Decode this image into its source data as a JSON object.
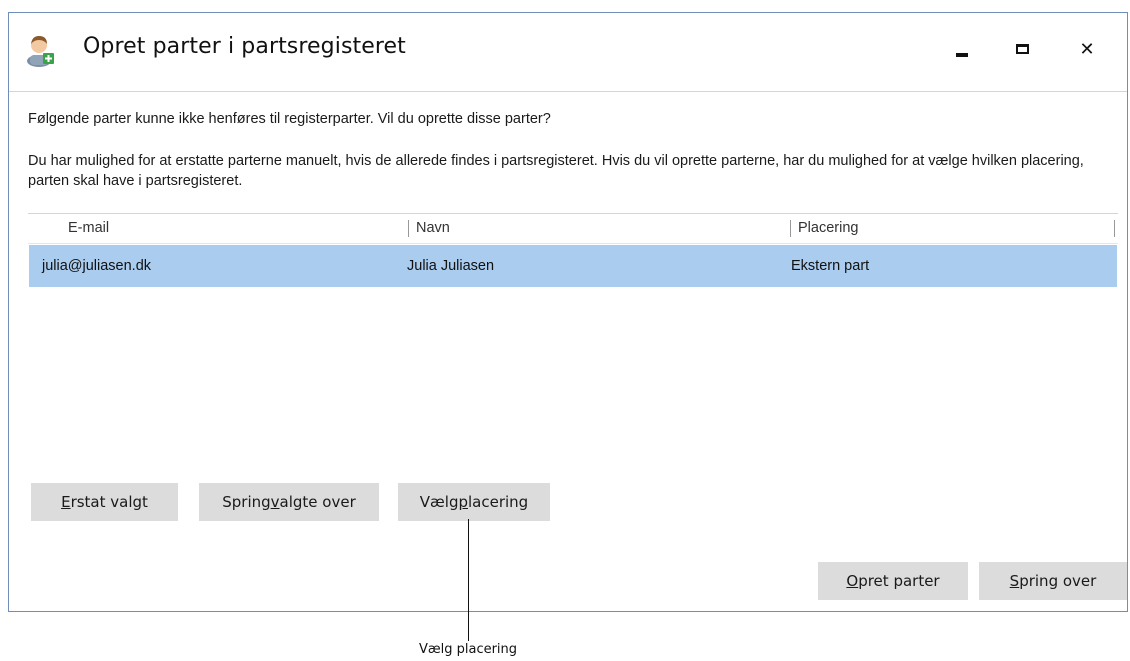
{
  "window": {
    "title": "Opret parter i partsregisteret",
    "icon": "user-add-icon",
    "controls": {
      "minimize": "minimize-icon",
      "maximize": "maximize-icon",
      "close": "close-icon",
      "close_glyph": "✕"
    }
  },
  "message": {
    "line1": "Følgende parter kunne ikke henføres til registerparter. Vil du oprette disse parter?",
    "line2": "Du har mulighed for at erstatte parterne manuelt, hvis de allerede findes i partsregisteret. Hvis du vil oprette parterne, har du mulighed for at vælge hvilken placering, parten skal have i partsregisteret."
  },
  "table": {
    "columns": [
      "E-mail",
      "Navn",
      "Placering"
    ],
    "rows": [
      {
        "email": "julia@juliasen.dk",
        "name": "Julia Juliasen",
        "placement": "Ekstern part",
        "selected": true
      }
    ],
    "selected_color": "#a9ccef"
  },
  "buttons": {
    "replace": {
      "pre": "",
      "u": "E",
      "post": "rstat valgt"
    },
    "skip_selected": {
      "pre": "Spring ",
      "u": "v",
      "post": "algte over"
    },
    "choose_placement": {
      "pre": "Vælg ",
      "u": "p",
      "post": "lacering"
    },
    "create": {
      "pre": "",
      "u": "O",
      "post": "pret parter"
    },
    "skip": {
      "pre": "",
      "u": "S",
      "post": "pring over"
    }
  },
  "callout": {
    "label": "Vælg placering"
  },
  "colors": {
    "window_border": "#6f8fb8",
    "button_bg": "#dcdcdc",
    "selection": "#a9ccef"
  }
}
